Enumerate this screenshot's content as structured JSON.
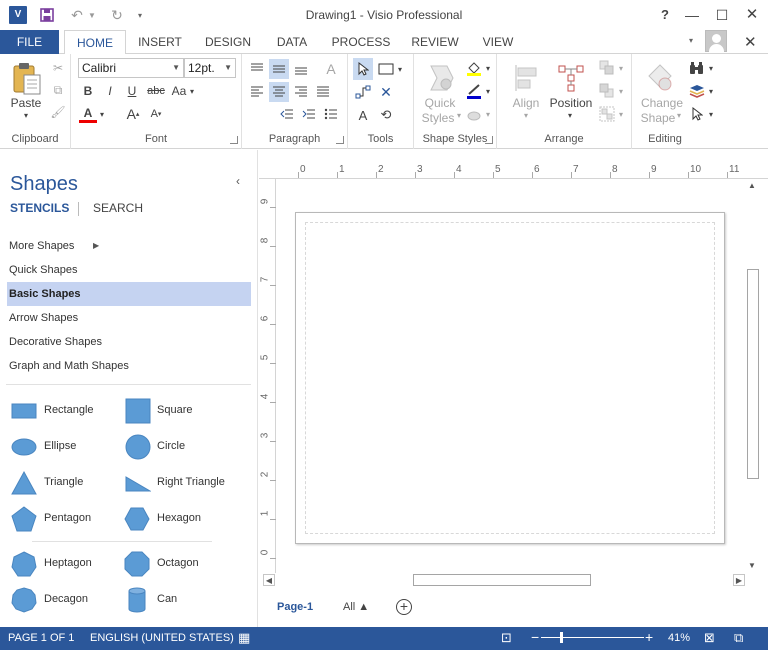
{
  "window": {
    "title": "Drawing1 - Visio Professional",
    "app_icon_text": "V",
    "help": "?",
    "minimize": "—",
    "maximize": "☐",
    "close": "✕"
  },
  "quick_access": {
    "save_icon": "save-icon",
    "undo_icon": "undo-icon",
    "redo_icon": "redo-icon"
  },
  "tabs": [
    "FILE",
    "HOME",
    "INSERT",
    "DESIGN",
    "DATA",
    "PROCESS",
    "REVIEW",
    "VIEW"
  ],
  "active_tab": "HOME",
  "ribbon": {
    "clipboard": {
      "label": "Clipboard",
      "paste": "Paste"
    },
    "font": {
      "label": "Font",
      "family": "Calibri",
      "size": "12pt.",
      "bold": "B",
      "italic": "I",
      "underline": "U",
      "strike": "abc",
      "case": "Aa",
      "grow": "A",
      "shrink": "A",
      "color_letter": "A"
    },
    "paragraph": {
      "label": "Paragraph"
    },
    "tools": {
      "label": "Tools"
    },
    "shape_styles": {
      "label": "Shape Styles",
      "quick_styles_1": "Quick",
      "quick_styles_2": "Styles"
    },
    "arrange": {
      "label": "Arrange",
      "align": "Align",
      "position": "Position"
    },
    "editing": {
      "label": "Editing",
      "change_shape_1": "Change",
      "change_shape_2": "Shape"
    }
  },
  "shapes_panel": {
    "title": "Shapes",
    "tab_stencils": "STENCILS",
    "tab_search": "SEARCH",
    "stencils": [
      {
        "label": "More Shapes"
      },
      {
        "label": "Quick Shapes"
      },
      {
        "label": "Basic Shapes"
      },
      {
        "label": "Arrow Shapes"
      },
      {
        "label": "Decorative Shapes"
      },
      {
        "label": "Graph and Math Shapes"
      }
    ],
    "selected_stencil": "Basic Shapes",
    "shapes": [
      "Rectangle",
      "Square",
      "Ellipse",
      "Circle",
      "Triangle",
      "Right Triangle",
      "Pentagon",
      "Hexagon",
      "Heptagon",
      "Octagon",
      "Decagon",
      "Can"
    ],
    "shape_color": "#5b9bd5"
  },
  "rulers": {
    "horizontal": [
      "0",
      "1",
      "2",
      "3",
      "4",
      "5",
      "6",
      "7",
      "8",
      "9",
      "10",
      "11"
    ],
    "vertical": [
      "9",
      "8",
      "7",
      "6",
      "5",
      "4",
      "3",
      "2",
      "1",
      "0"
    ]
  },
  "page_tabs": {
    "active": "Page-1",
    "all": "All ▲"
  },
  "status": {
    "page": "PAGE 1 OF 1",
    "language": "ENGLISH (UNITED STATES)",
    "zoom": "41%",
    "zoom_fraction": 0.41
  },
  "colors": {
    "accent": "#2b579a",
    "selected_stencil_bg": "#c5d3f1",
    "ribbon_selected_bg": "#c9daf1"
  }
}
